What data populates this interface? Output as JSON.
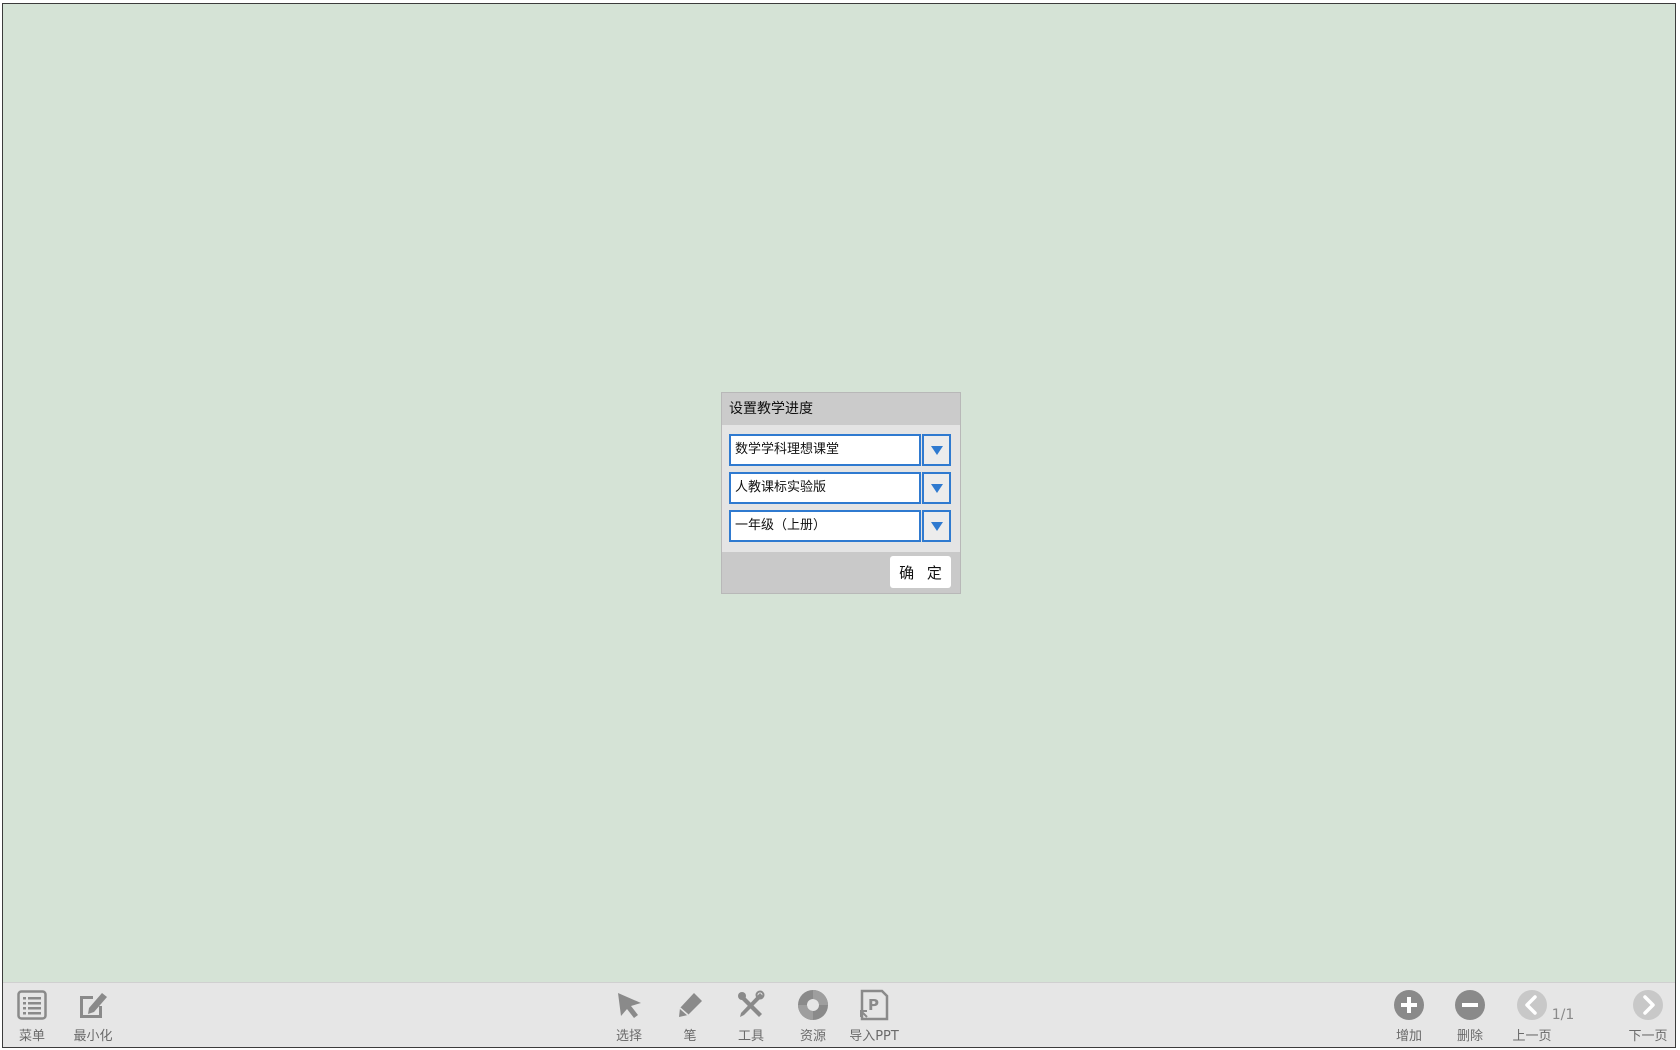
{
  "dialog": {
    "title": "设置教学进度",
    "selects": [
      {
        "value": "数学学科理想课堂"
      },
      {
        "value": "人教课标实验版"
      },
      {
        "value": "一年级（上册）"
      }
    ],
    "confirm_label": "确 定"
  },
  "toolbar": {
    "left": [
      {
        "label": "菜单",
        "icon": "menu-list-icon"
      },
      {
        "label": "最小化",
        "icon": "minimize-edit-icon"
      }
    ],
    "center": [
      {
        "label": "选择",
        "icon": "cursor-arrow-icon"
      },
      {
        "label": "笔",
        "icon": "pen-icon"
      },
      {
        "label": "工具",
        "icon": "tools-icon"
      },
      {
        "label": "资源",
        "icon": "resource-icon"
      },
      {
        "label": "导入PPT",
        "icon": "import-ppt-icon"
      }
    ],
    "right": [
      {
        "label": "增加",
        "icon": "plus-circle-icon"
      },
      {
        "label": "删除",
        "icon": "minus-circle-icon"
      },
      {
        "label": "上一页",
        "icon": "chevron-left-circle-icon"
      },
      {
        "label": "下一页",
        "icon": "chevron-right-circle-icon"
      }
    ],
    "page_counter": "1/1"
  },
  "colors": {
    "canvas_bg": "#d5e3d6",
    "toolbar_bg": "#e6e6e6",
    "accent_blue": "#2f7ad0",
    "icon_gray": "#8a8a8a"
  }
}
